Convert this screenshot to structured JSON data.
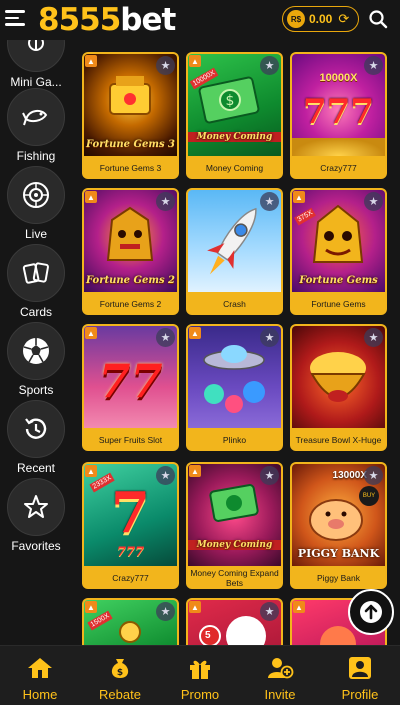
{
  "header": {
    "logo_digits": "8555",
    "logo_word": "bet",
    "currency_symbol": "R$",
    "balance": "0.00"
  },
  "sidebar": {
    "items": [
      {
        "label": "Mini Ga...",
        "icon": "mini-games-icon"
      },
      {
        "label": "Fishing",
        "icon": "fish-icon"
      },
      {
        "label": "Live",
        "icon": "roulette-icon"
      },
      {
        "label": "Cards",
        "icon": "cards-icon"
      },
      {
        "label": "Sports",
        "icon": "soccer-ball-icon"
      },
      {
        "label": "Recent",
        "icon": "history-icon"
      },
      {
        "label": "Favorites",
        "icon": "star-icon"
      }
    ]
  },
  "games": [
    {
      "name": "Fortune Gems 3",
      "art_text": "Fortune Gems 3"
    },
    {
      "name": "Money Coming",
      "art_text": "Money Coming",
      "badge": "10000X"
    },
    {
      "name": "Crazy777",
      "art_text": "10000X"
    },
    {
      "name": "Fortune Gems 2",
      "art_text": "Fortune Gems 2"
    },
    {
      "name": "Crash",
      "art_text": ""
    },
    {
      "name": "Fortune Gems",
      "art_text": "Fortune Gems",
      "badge": "375X"
    },
    {
      "name": "Super Fruits Slot",
      "art_text": ""
    },
    {
      "name": "Plinko",
      "art_text": ""
    },
    {
      "name": "Treasure Bowl X-Huge",
      "art_text": ""
    },
    {
      "name": "Crazy777",
      "art_text": "777",
      "badge": "2333X"
    },
    {
      "name": "Money Coming Expand Bets",
      "art_text": "Money Coming"
    },
    {
      "name": "Piggy Bank",
      "art_text": "PIGGY BANK",
      "badge": "13000X"
    },
    {
      "name": "",
      "art_text": "",
      "badge": "1500X"
    },
    {
      "name": "",
      "art_text": "5"
    },
    {
      "name": "",
      "art_text": ""
    }
  ],
  "bottom_nav": [
    {
      "label": "Home",
      "icon": "home-icon"
    },
    {
      "label": "Rebate",
      "icon": "money-bag-icon"
    },
    {
      "label": "Promo",
      "icon": "gift-icon"
    },
    {
      "label": "Invite",
      "icon": "invite-user-icon"
    },
    {
      "label": "Profile",
      "icon": "profile-icon"
    }
  ],
  "colors": {
    "accent": "#ffc21a",
    "card_frame": "#f2b51c",
    "background": "#161616"
  }
}
